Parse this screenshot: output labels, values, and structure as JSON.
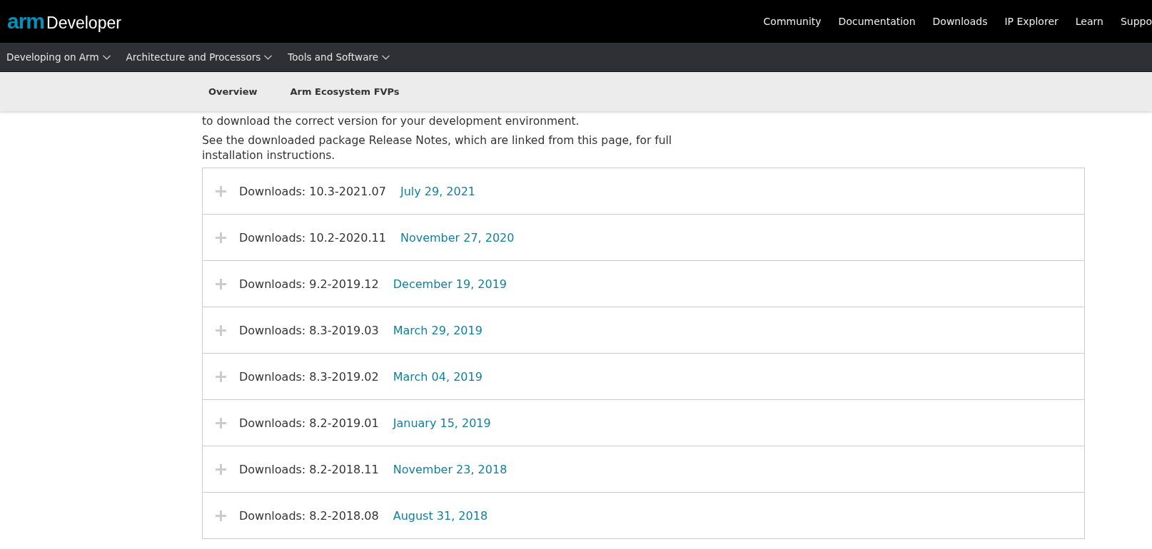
{
  "header": {
    "logo_mark": "arm",
    "logo_text": "Developer",
    "links": [
      "Community",
      "Documentation",
      "Downloads",
      "IP Explorer",
      "Learn",
      "Suppo"
    ]
  },
  "main_nav": [
    "Developing on Arm",
    "Architecture and Processors",
    "Tools and Software"
  ],
  "sub_nav": [
    "Overview",
    "Arm Ecosystem FVPs"
  ],
  "paragraphs": [
    "to download the correct version for your development environment.",
    "See the downloaded package Release Notes, which are linked from this page, for full installation instructions."
  ],
  "downloads": [
    {
      "label": "Downloads: 10.3-2021.07",
      "date": "July 29, 2021",
      "expanded": false
    },
    {
      "label": "Downloads: 10.2-2020.11",
      "date": "November 27, 2020",
      "expanded": false
    },
    {
      "label": "Downloads: 9.2-2019.12",
      "date": "December 19, 2019",
      "expanded": false
    },
    {
      "label": "Downloads: 8.3-2019.03",
      "date": "March 29, 2019",
      "expanded": false
    },
    {
      "label": "Downloads: 8.3-2019.02",
      "date": "March 04, 2019",
      "expanded": false
    },
    {
      "label": "Downloads: 8.2-2019.01",
      "date": "January 15, 2019",
      "expanded": false
    },
    {
      "label": "Downloads: 8.2-2018.11",
      "date": "November 23, 2018",
      "expanded": false
    },
    {
      "label": "Downloads: 8.2-2018.08",
      "date": "August 31, 2018",
      "expanded": false
    }
  ]
}
